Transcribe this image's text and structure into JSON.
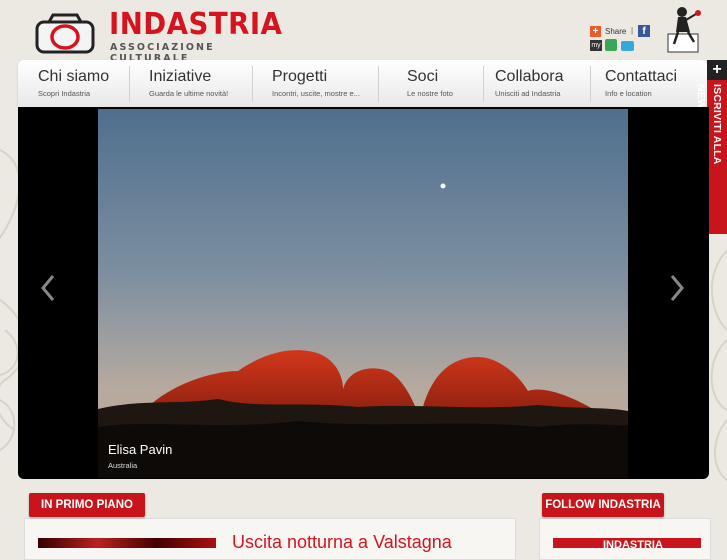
{
  "header": {
    "brand": "INDASTRIA",
    "tagline": "ASSOCIAZIONE CULTURALE",
    "share_label": "Share",
    "share_separator": "|"
  },
  "nav": [
    {
      "title": "Chi siamo",
      "subtitle": "Scopri Indastria"
    },
    {
      "title": "Iniziative",
      "subtitle": "Guarda le ultime novità!"
    },
    {
      "title": "Progetti",
      "subtitle": "Incontri, uscite, mostre e..."
    },
    {
      "title": "Soci",
      "subtitle": "Le nostre foto"
    },
    {
      "title": "Collabora",
      "subtitle": "Unisciti ad Indastria"
    },
    {
      "title": "Contattaci",
      "subtitle": "Info e location"
    }
  ],
  "newsletter": {
    "label": "ISCRIVITI ALLA NEWSLETTER",
    "plus": "+"
  },
  "slider": {
    "photographer": "Elisa Pavin",
    "location": "Australia"
  },
  "sections": {
    "primo_piano": "IN PRIMO PIANO",
    "follow": "FOLLOW INDASTRIA",
    "headline": "Uscita notturna a Valstagna",
    "follow_logo_text": "INDASTRIA"
  },
  "colors": {
    "accent": "#c8141b",
    "brand": "#d4151f",
    "background": "#ece9e2"
  },
  "icons": [
    "camera-logo-icon",
    "share-plus-icon",
    "facebook-icon",
    "myspace-icon",
    "delicious-icon",
    "twitter-icon",
    "mascot-icon",
    "arrow-left-icon",
    "arrow-right-icon"
  ]
}
